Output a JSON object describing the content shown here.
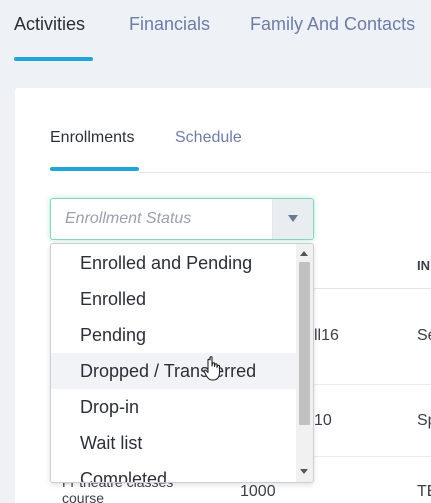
{
  "top_tabs": [
    {
      "label": "Activities",
      "active": true
    },
    {
      "label": "Financials",
      "active": false
    },
    {
      "label": "Family And Contacts",
      "active": false
    }
  ],
  "sub_tabs": [
    {
      "label": "Enrollments",
      "active": true
    },
    {
      "label": "Schedule",
      "active": false
    }
  ],
  "status_select": {
    "placeholder": "Enrollment Status",
    "arrow_icon": "caret-down-icon"
  },
  "status_options": [
    "Enrolled and Pending",
    "Enrolled",
    "Pending",
    "Dropped / Transferred",
    "Drop-in",
    "Wait list",
    "Completed"
  ],
  "hovered_option": "Dropped / Transferred",
  "background_table": {
    "header_partial": "IN",
    "row_fragments": [
      "ll16",
      "Se",
      "10",
      "Sp",
      "TE"
    ],
    "bottom_row": {
      "name_partial": "Fr theatre classes course",
      "value": "1000"
    }
  },
  "colors": {
    "accent": "#1fa6d9",
    "inactive_tab": "#6e7da6",
    "focus_border": "#7fd8b4"
  }
}
